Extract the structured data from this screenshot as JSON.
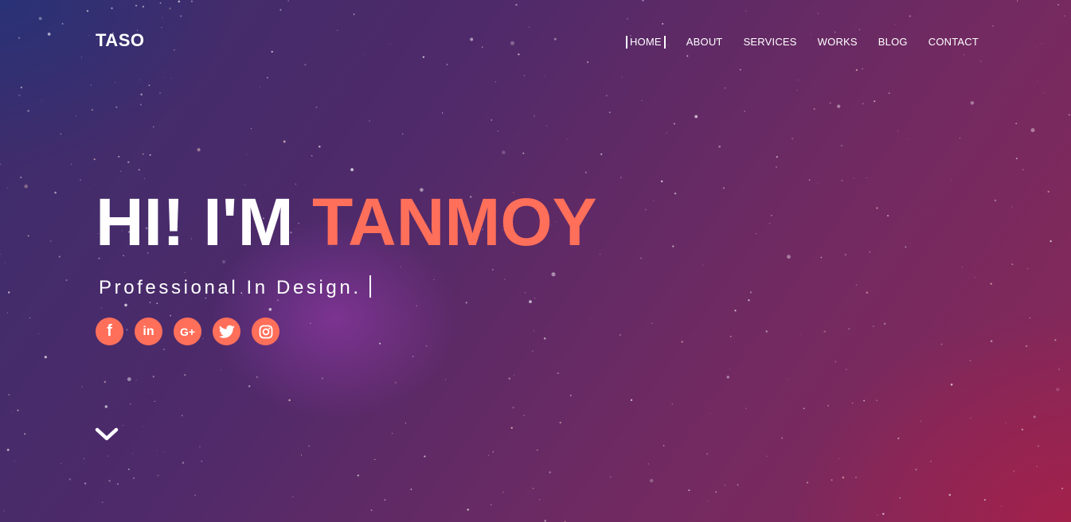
{
  "brand": {
    "logo": "TASO"
  },
  "nav": {
    "items": [
      {
        "label": "HOME",
        "active": true
      },
      {
        "label": "ABOUT"
      },
      {
        "label": "SERVICES"
      },
      {
        "label": "WORKS"
      },
      {
        "label": "BLOG"
      },
      {
        "label": "CONTACT"
      }
    ]
  },
  "hero": {
    "greeting": "HI! I'M",
    "name": "TANMOY",
    "tagline": "Professional In Design."
  },
  "social": [
    {
      "icon": "facebook-icon",
      "glyph": "f"
    },
    {
      "icon": "linkedin-icon",
      "glyph": "in"
    },
    {
      "icon": "google-plus-icon",
      "glyph": "G+"
    },
    {
      "icon": "twitter-icon"
    },
    {
      "icon": "instagram-icon"
    }
  ],
  "scroll": {
    "icon": "chevron-down-icon"
  },
  "colors": {
    "accent": "#ff6f5a",
    "text": "#ffffff"
  }
}
